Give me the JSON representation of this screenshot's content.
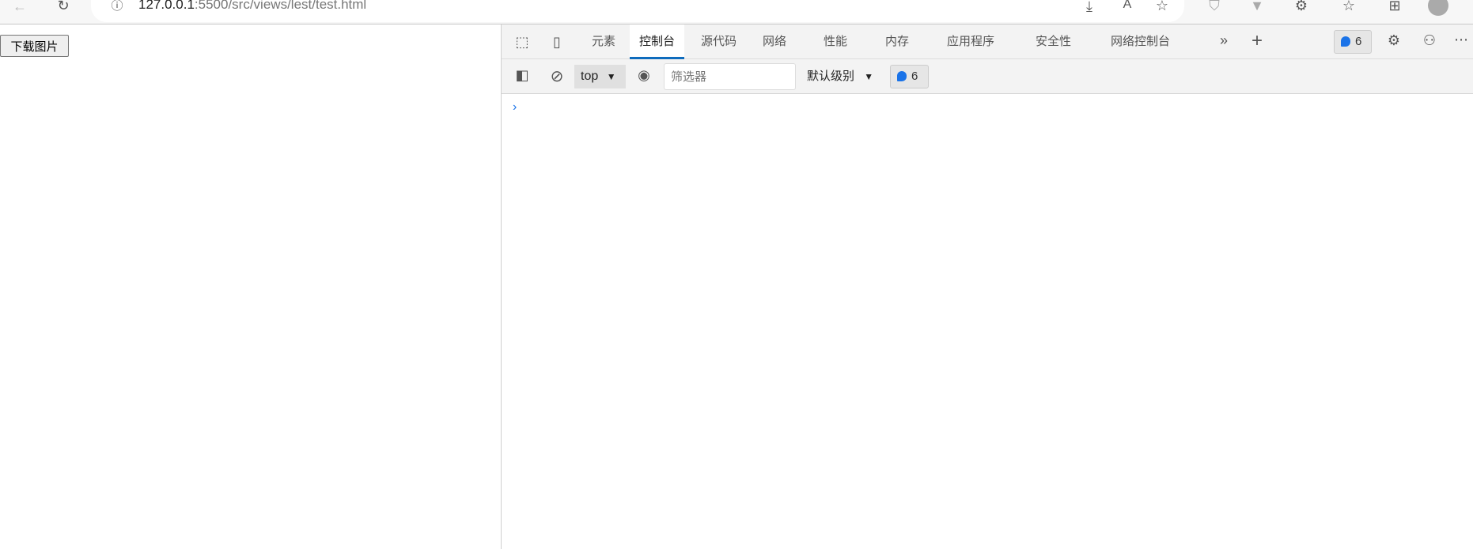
{
  "browser": {
    "url_host": "127.0.0.1",
    "url_path": ":5500/src/views/lest/test.html"
  },
  "page": {
    "download_button": "下载图片"
  },
  "devtools": {
    "tabs": [
      "元素",
      "控制台",
      "源代码",
      "网络",
      "性能",
      "内存",
      "应用程序",
      "安全性",
      "网络控制台"
    ],
    "active_tab": "控制台",
    "issues_count": "6",
    "toolbar": {
      "context": "top",
      "filter_placeholder": "筛选器",
      "level": "默认级别",
      "message_count": "6"
    },
    "prompt": "›"
  }
}
